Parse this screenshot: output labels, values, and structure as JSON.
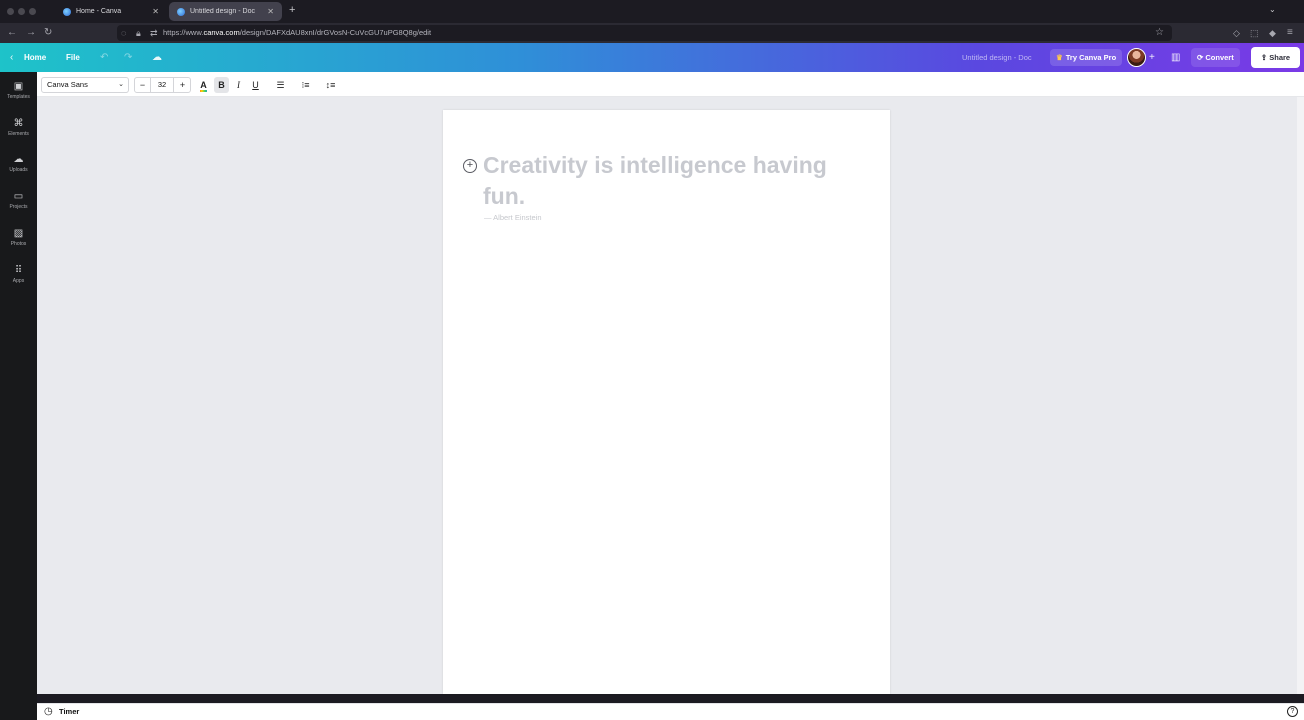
{
  "browser": {
    "tabs": [
      {
        "label": "Home - Canva",
        "active": false
      },
      {
        "label": "Untitled design - Doc",
        "active": true
      }
    ],
    "new_tab": "+",
    "url_prefix": "https://www.",
    "url_domain": "canva.com",
    "url_path": "/design/DAFXdAU8xnI/drGVosN-CuVcGU7uPG8Q8g/edit"
  },
  "header": {
    "home_label": "Home",
    "file_label": "File",
    "doc_title": "Untitled design - Doc",
    "try_pro_label": "Try Canva Pro",
    "convert_label": "Convert",
    "share_label": "Share"
  },
  "sidebar": {
    "items": [
      {
        "label": "Templates",
        "icon": "templates-icon"
      },
      {
        "label": "Elements",
        "icon": "elements-icon"
      },
      {
        "label": "Uploads",
        "icon": "uploads-icon"
      },
      {
        "label": "Projects",
        "icon": "projects-icon"
      },
      {
        "label": "Photos",
        "icon": "photos-icon"
      },
      {
        "label": "Apps",
        "icon": "apps-icon"
      }
    ]
  },
  "toolbar": {
    "font_family": "Canva Sans",
    "font_size": "32",
    "decrease": "−",
    "increase": "+",
    "bold": "B",
    "italic": "I",
    "underline": "U"
  },
  "document": {
    "quote": "Creativity is intelligence having fun.",
    "author": "— Albert Einstein"
  },
  "footer": {
    "timer_label": "Timer"
  },
  "colors": {
    "header_gradient_start": "#1ec3c9",
    "header_gradient_end": "#7a3ae6",
    "canvas_bg": "#e9eaee",
    "placeholder_text": "#c7c9cf"
  }
}
